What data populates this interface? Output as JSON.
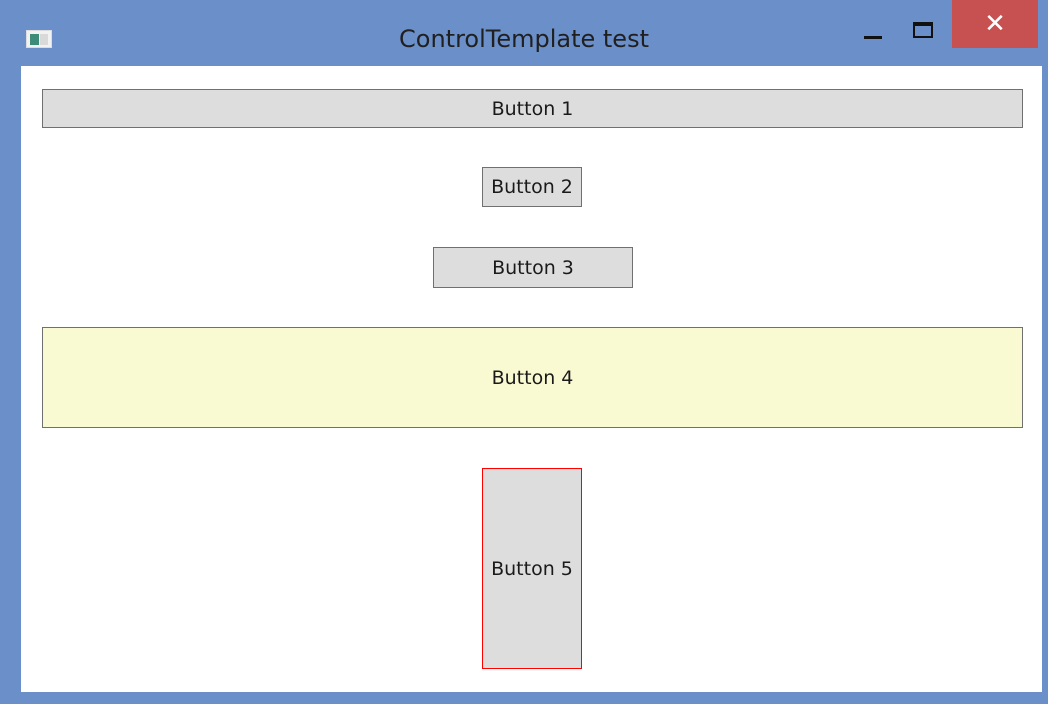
{
  "window": {
    "title": "ControlTemplate test",
    "controls": {
      "minimize_icon": "minimize-icon",
      "maximize_icon": "maximize-icon",
      "close_icon": "close-icon",
      "close_glyph": "✕"
    }
  },
  "buttons": [
    {
      "label": "Button 1"
    },
    {
      "label": "Button 2"
    },
    {
      "label": "Button 3"
    },
    {
      "label": "Button 4"
    },
    {
      "label": "Button 5"
    }
  ],
  "colors": {
    "frame": "#6b8fc9",
    "close_bg": "#c75050",
    "button_bg": "#dddddd",
    "button4_bg": "#fafad2",
    "button5_border": "#ff0000"
  }
}
